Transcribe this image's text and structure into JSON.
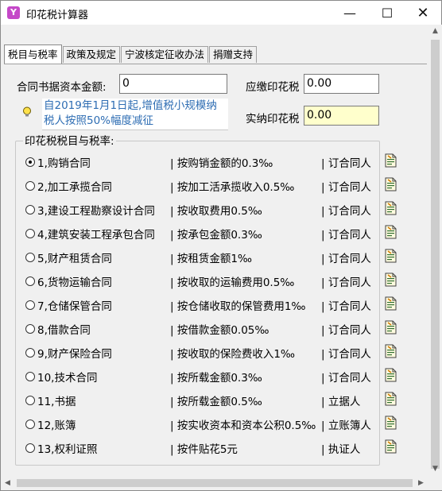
{
  "window": {
    "title": "印花税计算器",
    "app_icon_letter": "Y",
    "minimize_glyph": "—",
    "maximize_glyph": "☐",
    "close_glyph": "✕"
  },
  "tabs": [
    {
      "label": "税目与税率",
      "active": true
    },
    {
      "label": "政策及规定",
      "active": false
    },
    {
      "label": "宁波核定征收办法",
      "active": false
    },
    {
      "label": "捐赠支持",
      "active": false
    }
  ],
  "form": {
    "capital_label": "合同书据资本金额:",
    "capital_value": "0",
    "payable_label": "应缴印花税",
    "payable_value": "0.00",
    "actual_label": "实纳印花税",
    "actual_value": "0.00"
  },
  "notice": {
    "icon": "lightbulb-icon",
    "line1": "自2019年1月1日起,增值税小规模纳",
    "line2": "税人按照50%幅度减征"
  },
  "rates_group": {
    "legend": "印花税税目与税率:",
    "rows": [
      {
        "item": "1,购销合同",
        "rate": "| 按购销金额的0.3‰",
        "payer": "| 订合同人",
        "checked": true
      },
      {
        "item": "2,加工承揽合同",
        "rate": "| 按加工活承揽收入0.5‰",
        "payer": "| 订合同人",
        "checked": false
      },
      {
        "item": "3,建设工程勘察设计合同",
        "rate": "| 按收取费用0.5‰",
        "payer": "| 订合同人",
        "checked": false
      },
      {
        "item": "4,建筑安装工程承包合同",
        "rate": "| 按承包金额0.3‰",
        "payer": "| 订合同人",
        "checked": false
      },
      {
        "item": "5,财产租赁合同",
        "rate": "| 按租赁金额1‰",
        "payer": "| 订合同人",
        "checked": false
      },
      {
        "item": "6,货物运输合同",
        "rate": "| 按收取的运输费用0.5‰",
        "payer": "| 订合同人",
        "checked": false
      },
      {
        "item": "7,仓储保管合同",
        "rate": "| 按仓储收取的保管费用1‰",
        "payer": "| 订合同人",
        "checked": false
      },
      {
        "item": "8,借款合同",
        "rate": "| 按借款金额0.05‰",
        "payer": "| 订合同人",
        "checked": false
      },
      {
        "item": "9,财产保险合同",
        "rate": "| 按收取的保险费收入1‰",
        "payer": "| 订合同人",
        "checked": false
      },
      {
        "item": "10,技术合同",
        "rate": "| 按所载金额0.3‰",
        "payer": "| 订合同人",
        "checked": false
      },
      {
        "item": "11,书据",
        "rate": "| 按所载金额0.5‰",
        "payer": "| 立据人",
        "checked": false
      },
      {
        "item": "12,账簿",
        "rate": "| 按实收资本和资本公积0.5‰",
        "payer": "| 立账簿人",
        "checked": false
      },
      {
        "item": "13,权利证照",
        "rate": "| 按件贴花5元",
        "payer": "| 执证人",
        "checked": false
      }
    ]
  },
  "scrollbars": {
    "up": "▲",
    "down": "▼",
    "left": "◀",
    "right": "▶"
  }
}
